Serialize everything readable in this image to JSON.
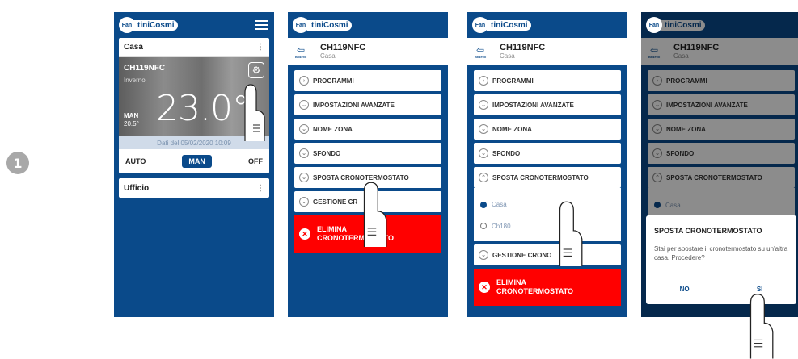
{
  "step_number": "1",
  "brand": {
    "logo_badge": "Fan",
    "logo_text": "tiniCosmi"
  },
  "phone1": {
    "home_name": "Casa",
    "device_name": "CH119NFC",
    "season": "Inverno",
    "temperature": "23.0°",
    "mode_label": "MAN",
    "setpoint": "20.5°",
    "date_text": "Dati del 05/02/2020 10:09",
    "mode_auto": "AUTO",
    "mode_man": "MAN",
    "mode_off": "OFF",
    "home2_name": "Ufficio"
  },
  "device_header": {
    "back_label": "INDIETRO",
    "title": "CH119NFC",
    "subtitle": "Casa"
  },
  "menu": {
    "programmi": "PROGRAMMI",
    "impostazioni": "IMPOSTAZIONI AVANZATE",
    "nome_zona": "NOME ZONA",
    "sfondo": "SFONDO",
    "sposta": "SPOSTA CRONOTERMOSTATO",
    "gestione": "GESTIONE CRONO",
    "elimina_l1": "ELIMINA",
    "elimina_l2": "CRONOTERMOSTATO"
  },
  "phone2": {
    "sposta_clipped": "SPOSTA CRONOTERMOSTATO",
    "gestione_clipped": "GESTIONE CR",
    "elimina_l2_clipped": "CRONOTERMOSTATO"
  },
  "phone3": {
    "option_casa": "Casa",
    "option_ch180": "Ch180",
    "gestione_clipped": "GESTIONE CRONO"
  },
  "dialog": {
    "title": "SPOSTA CRONOTERMOSTATO",
    "message": "Stai per spostare il cronotermostato su un'altra casa. Procedere?",
    "no": "NO",
    "yes": "SI"
  }
}
